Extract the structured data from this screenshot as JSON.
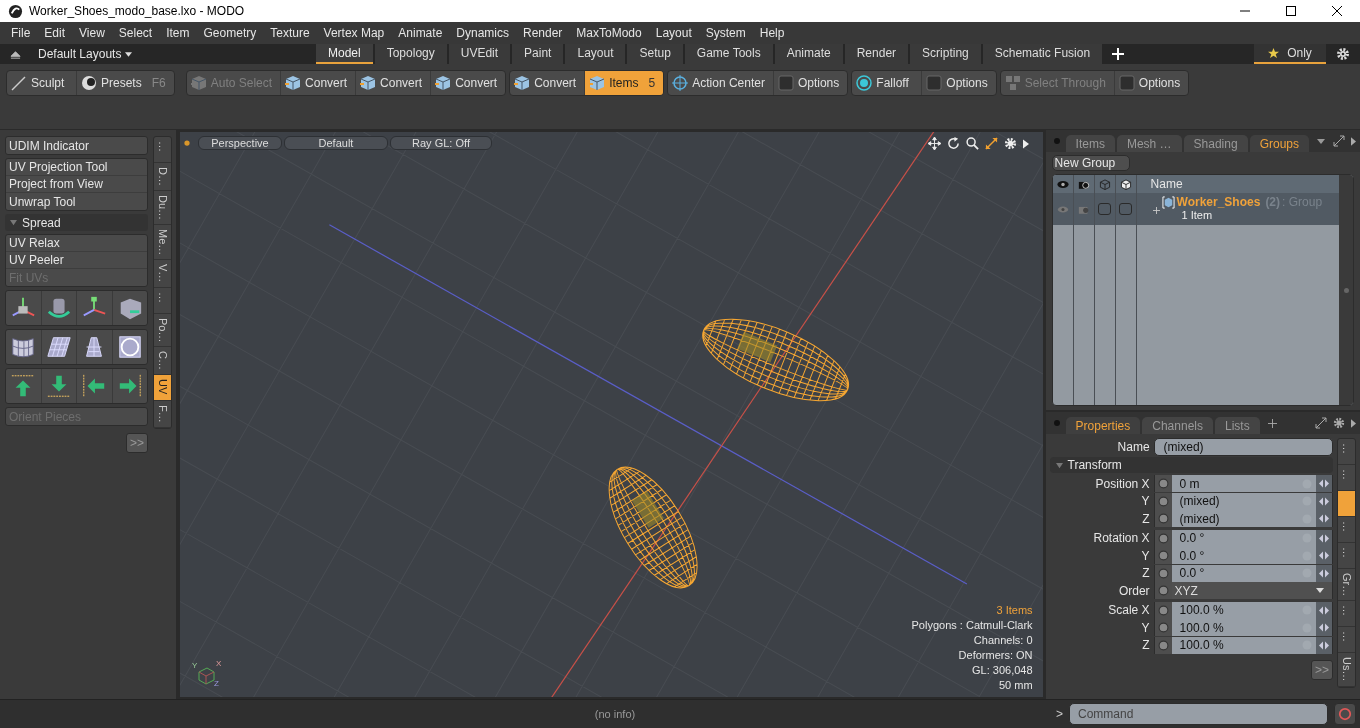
{
  "window": {
    "title": "Worker_Shoes_modo_base.lxo - MODO"
  },
  "menu": [
    "File",
    "Edit",
    "View",
    "Select",
    "Item",
    "Geometry",
    "Texture",
    "Vertex Map",
    "Animate",
    "Dynamics",
    "Render",
    "MaxToModo",
    "Layout",
    "System",
    "Help"
  ],
  "layout_bar": {
    "layouts": "Default Layouts",
    "tabs": [
      {
        "label": "Model",
        "selected": true
      },
      {
        "label": "Topology",
        "selected": false
      },
      {
        "label": "UVEdit",
        "selected": false
      },
      {
        "label": "Paint",
        "selected": false
      },
      {
        "label": "Layout",
        "selected": false
      },
      {
        "label": "Setup",
        "selected": false
      },
      {
        "label": "Game Tools",
        "selected": false
      },
      {
        "label": "Animate",
        "selected": false
      },
      {
        "label": "Render",
        "selected": false
      },
      {
        "label": "Scripting",
        "selected": false
      },
      {
        "label": "Schematic Fusion",
        "selected": false
      }
    ],
    "only": {
      "label": "Only",
      "selected": true
    }
  },
  "toolbar": {
    "groups": [
      [
        {
          "label": "Sculpt",
          "kind": "brush",
          "disabled": false,
          "selected": false
        },
        {
          "label": "Presets",
          "kind": "sphere",
          "shortcut": "F6",
          "disabled": false,
          "selected": false
        }
      ],
      [
        {
          "label": "Auto Select",
          "kind": "cube",
          "disabled": true,
          "selected": false
        },
        {
          "label": "Convert",
          "kind": "cube",
          "disabled": false,
          "selected": false
        },
        {
          "label": "Convert",
          "kind": "cube",
          "disabled": false,
          "selected": false
        },
        {
          "label": "Convert",
          "kind": "cube",
          "disabled": false,
          "selected": false
        }
      ],
      [
        {
          "label": "Convert",
          "kind": "cube",
          "disabled": false,
          "selected": false
        },
        {
          "label": "Items",
          "kind": "cube",
          "shortcut": "5",
          "disabled": false,
          "selected": true
        }
      ],
      [
        {
          "label": "Action Center",
          "kind": "crosshair",
          "disabled": false,
          "selected": false
        },
        {
          "label": "Options",
          "kind": "square",
          "disabled": false,
          "selected": false
        }
      ],
      [
        {
          "label": "Falloff",
          "kind": "target",
          "disabled": false,
          "selected": false
        },
        {
          "label": "Options",
          "kind": "square",
          "disabled": false,
          "selected": false
        }
      ],
      [
        {
          "label": "Select Through",
          "kind": "cubes",
          "disabled": true,
          "selected": false
        },
        {
          "label": "Options",
          "kind": "square",
          "disabled": false,
          "selected": false
        }
      ]
    ]
  },
  "left_panel": {
    "top_groups": [
      [
        {
          "label": "UDIM Indicator",
          "disabled": false
        }
      ],
      [
        {
          "label": "UV Projection Tool",
          "disabled": false
        },
        {
          "label": "Project from View",
          "disabled": false
        },
        {
          "label": "Unwrap Tool",
          "disabled": false
        }
      ]
    ],
    "header": {
      "label": "Spread",
      "expanded": true
    },
    "bottom_groups": [
      [
        {
          "label": "UV Relax",
          "disabled": false
        },
        {
          "label": "UV Peeler",
          "disabled": false
        },
        {
          "label": "Fit UVs",
          "disabled": true
        }
      ]
    ],
    "orient": {
      "label": "Orient Pieces",
      "disabled": true
    },
    "more": ">>",
    "side_tabs": [
      {
        "label": "…",
        "selected": false
      },
      {
        "label": "D…",
        "selected": false
      },
      {
        "label": "Du…",
        "selected": false
      },
      {
        "label": "Me…",
        "selected": false
      },
      {
        "label": "V…",
        "selected": false
      },
      {
        "label": "…",
        "selected": false
      },
      {
        "label": "Po…",
        "selected": false
      },
      {
        "label": "C…",
        "selected": false
      },
      {
        "label": "UV",
        "selected": true
      },
      {
        "label": "F…",
        "selected": false
      }
    ]
  },
  "viewport": {
    "buttons": [
      "Perspective",
      "Default",
      "Ray GL: Off"
    ],
    "stats": [
      {
        "text": "3 Items",
        "kind": "highlight"
      },
      {
        "text": "Polygons : Catmull-Clark",
        "kind": "plain"
      },
      {
        "text": "Channels: 0",
        "kind": "plain"
      },
      {
        "text": "Deformers: ON",
        "kind": "plain"
      },
      {
        "text": "GL: 306,048",
        "kind": "plain"
      },
      {
        "text": "50 mm",
        "kind": "plain"
      }
    ],
    "gizmo_axes": [
      "Y",
      "X",
      "Z"
    ]
  },
  "groups_panel": {
    "tabs": [
      {
        "label": "Items",
        "selected": false
      },
      {
        "label": "Mesh …",
        "selected": false
      },
      {
        "label": "Shading",
        "selected": false
      },
      {
        "label": "Groups",
        "selected": true
      }
    ],
    "new_group": "New Group",
    "column": "Name",
    "rows": [
      {
        "name": "Worker_Shoes",
        "count": "(2)",
        "type": ": Group",
        "detail": "1 Item",
        "expanded": false
      }
    ]
  },
  "properties": {
    "tabs": [
      {
        "label": "Properties",
        "selected": true
      },
      {
        "label": "Channels",
        "selected": false
      },
      {
        "label": "Lists",
        "selected": false
      }
    ],
    "name": {
      "label": "Name",
      "value": "(mixed)"
    },
    "section": {
      "label": "Transform",
      "expanded": true
    },
    "blocks": [
      [
        {
          "label": "Position X",
          "value": "0 m",
          "kind": "number"
        },
        {
          "label": "Y",
          "value": "(mixed)",
          "kind": "number"
        },
        {
          "label": "Z",
          "value": "(mixed)",
          "kind": "number"
        }
      ],
      [
        {
          "label": "Rotation X",
          "value": "0.0 °",
          "kind": "number"
        },
        {
          "label": "Y",
          "value": "0.0 °",
          "kind": "number"
        },
        {
          "label": "Z",
          "value": "0.0 °",
          "kind": "number"
        },
        {
          "label": "Order",
          "value": "XYZ",
          "kind": "dropdown"
        }
      ],
      [
        {
          "label": "Scale X",
          "value": "100.0 %",
          "kind": "number"
        },
        {
          "label": "Y",
          "value": "100.0 %",
          "kind": "number"
        },
        {
          "label": "Z",
          "value": "100.0 %",
          "kind": "number"
        }
      ]
    ],
    "more": ">>",
    "side_tabs": [
      {
        "label": "…",
        "selected": false
      },
      {
        "label": "…",
        "selected": false
      },
      {
        "selected": true
      },
      {
        "label": "…",
        "selected": false
      },
      {
        "label": "…",
        "selected": false
      },
      {
        "label": "Gr…",
        "selected": false
      },
      {
        "label": "…",
        "selected": false
      },
      {
        "label": "…",
        "selected": false
      },
      {
        "label": "Us…",
        "selected": false
      }
    ]
  },
  "status": {
    "info": "(no info)",
    "prompt": ">",
    "command_placeholder": "Command"
  }
}
